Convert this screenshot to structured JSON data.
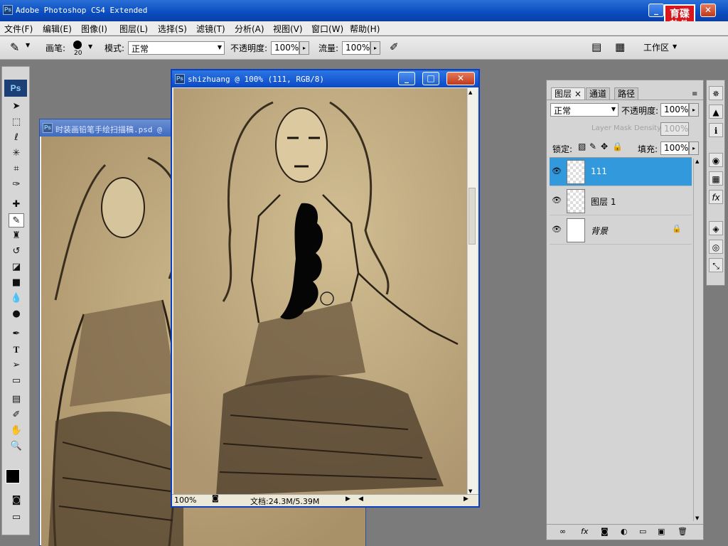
{
  "app": {
    "title": "Adobe Photoshop CS4 Extended",
    "ps": "Ps",
    "watermark": "育碟\n软件"
  },
  "menu": [
    "文件(F)",
    "编辑(E)",
    "图像(I)",
    "图层(L)",
    "选择(S)",
    "滤镜(T)",
    "分析(A)",
    "视图(V)",
    "窗口(W)",
    "帮助(H)"
  ],
  "options": {
    "brush_label": "画笔:",
    "brush_size": "20",
    "mode_label": "模式:",
    "mode_value": "正常",
    "opacity_label": "不透明度:",
    "opacity_value": "100%",
    "flow_label": "流量:",
    "flow_value": "100%",
    "workspace": "工作区"
  },
  "doc_back": {
    "title": "时装画铅笔手绘扫描稿.psd @"
  },
  "doc_front": {
    "title": "shizhuang @ 100% (111, RGB/8)",
    "zoom": "100%",
    "doc_info": "文档:24.3M/5.39M"
  },
  "panel": {
    "tabs": [
      "图层",
      "通道",
      "路径"
    ],
    "blend_mode": "正常",
    "opacity_label": "不透明度:",
    "opacity_value": "100%",
    "mask_density_label": "Layer Mask Density",
    "mask_density_value": "100%",
    "lock_label": "锁定:",
    "fill_label": "填充:",
    "fill_value": "100%",
    "layers": [
      {
        "name": "111",
        "selected": true
      },
      {
        "name": "图层 1",
        "selected": false
      },
      {
        "name": "背景",
        "selected": false
      }
    ]
  },
  "colors": {
    "title_blue": "#0a4cc0",
    "selected_layer": "#3399dd",
    "paper": "#c2ae82"
  }
}
